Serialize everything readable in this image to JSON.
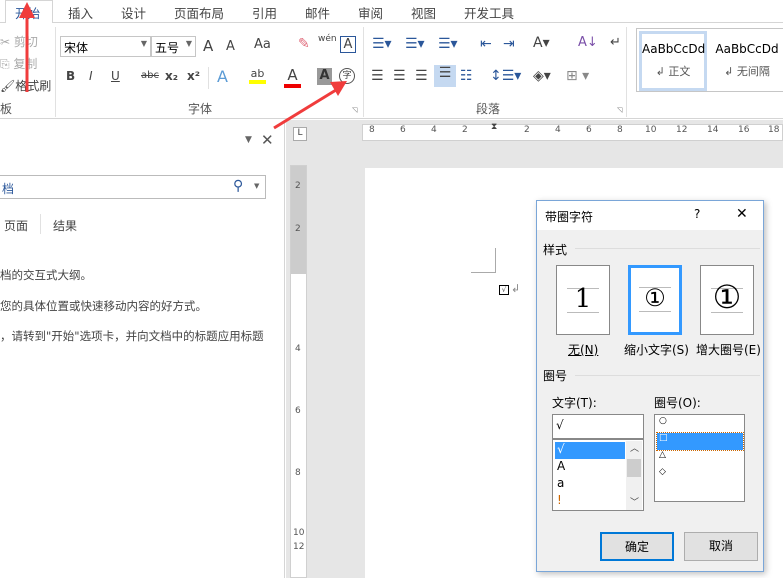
{
  "tabs": [
    "开始",
    "插入",
    "设计",
    "页面布局",
    "引用",
    "邮件",
    "审阅",
    "视图",
    "开发工具"
  ],
  "clipboard": {
    "cut": "剪切",
    "copy": "复制",
    "format_painter": "格式刷",
    "group_label": "板"
  },
  "font": {
    "name": "宋体",
    "size": "五号",
    "group_label": "字体",
    "grow": "A",
    "shrink": "A",
    "case": "Aa",
    "phonetic": "wén",
    "bold": "B",
    "italic": "I",
    "underline": "U",
    "strike": "abc",
    "sub": "x₂",
    "sup": "x²",
    "enclose_char": "字",
    "border_char": "A",
    "shade_char": "A",
    "effects": "A",
    "color": "A",
    "highlight": "ab"
  },
  "paragraph": {
    "group_label": "段落"
  },
  "styles": [
    {
      "preview": "AaBbCcDd",
      "name": "↲ 正文"
    },
    {
      "preview": "AaBbCcDd",
      "name": "↲ 无间隔"
    }
  ],
  "nav": {
    "search_value": "档",
    "tabs": [
      "页面",
      "结果"
    ],
    "lines": [
      "档的交互式大纲。",
      "您的具体位置或快速移动内容的好方式。",
      "，请转到\"开始\"选项卡，并向文档中的标题应用标题"
    ]
  },
  "hruler": [
    "8",
    "6",
    "4",
    "2",
    "2",
    "4",
    "6",
    "8",
    "10",
    "12",
    "14",
    "16",
    "18"
  ],
  "vruler": [
    "2",
    "2",
    "4",
    "6",
    "8",
    "10",
    "12"
  ],
  "dialog": {
    "title": "带圈字符",
    "help": "?",
    "close": "✕",
    "style_label": "样式",
    "styles": [
      {
        "glyph": "1",
        "label": "无(N)"
      },
      {
        "glyph": "①",
        "label": "缩小文字(S)"
      },
      {
        "glyph": "①",
        "label": "增大圈号(E)"
      }
    ],
    "enclosure_label": "圈号",
    "text_label": "文字(T):",
    "text_value": "√",
    "text_options": [
      "√",
      "A",
      "a",
      "!"
    ],
    "enclosure_label2": "圈号(O):",
    "enclosure_options": [
      "○",
      "□",
      "△",
      "◇"
    ],
    "ok": "确定",
    "cancel": "取消"
  },
  "colors": {
    "accent": "#2b579a",
    "selection": "#3399ff",
    "arrow": "#f03c3c"
  }
}
